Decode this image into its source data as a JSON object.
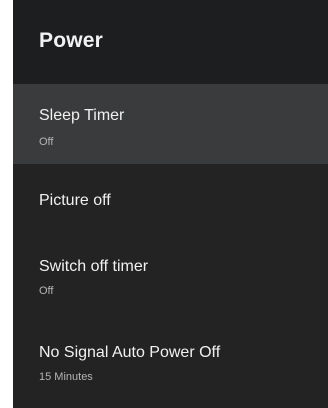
{
  "panel": {
    "title": "Power"
  },
  "items": [
    {
      "label": "Sleep Timer",
      "value": "Off",
      "focused": true
    },
    {
      "label": "Picture off"
    },
    {
      "label": "Switch off timer",
      "value": "Off"
    },
    {
      "label": "No Signal Auto Power Off",
      "value": "15 Minutes"
    }
  ],
  "colors": {
    "panel_background": "#232323",
    "header_background": "#1d1e20",
    "focused_item": "#3a3b3c",
    "primary_text": "#f1f1f1",
    "secondary_text": "#b4b4b4"
  }
}
